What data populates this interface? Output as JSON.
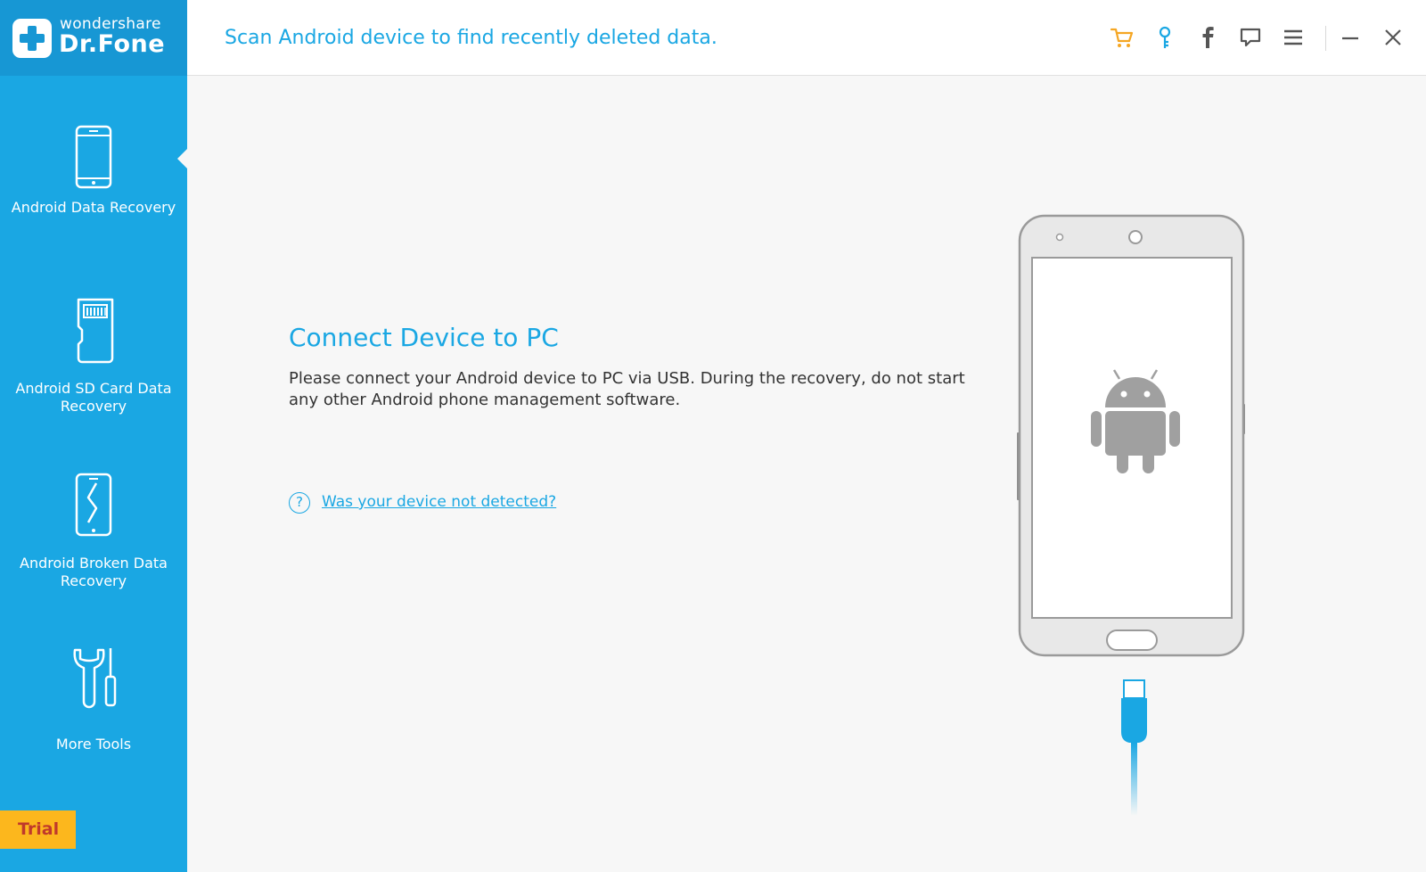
{
  "brand": {
    "name_small": "wondershare",
    "name_big": "Dr.Fone"
  },
  "header": {
    "title": "Scan Android device to find recently deleted data.",
    "icons": [
      "cart-icon",
      "key-icon",
      "facebook-icon",
      "chat-icon",
      "menu-icon",
      "minimize-icon",
      "close-icon"
    ],
    "accent_color": "#1aa7e3",
    "cart_color": "#f5a623"
  },
  "sidebar": {
    "items": [
      {
        "label": "Android Data Recovery",
        "icon": "phone-icon",
        "active": true
      },
      {
        "label": "Android SD Card Data Recovery",
        "icon": "sd-card-icon",
        "active": false
      },
      {
        "label": "Android Broken Data Recovery",
        "icon": "broken-phone-icon",
        "active": false
      },
      {
        "label": "More Tools",
        "icon": "tools-icon",
        "active": false
      }
    ],
    "trial_label": "Trial",
    "background": "#1aa7e3"
  },
  "main": {
    "connect_title": "Connect Device to PC",
    "connect_description": "Please connect your Android device to PC via USB. During the recovery, do not start any other Android phone management software.",
    "help_icon_glyph": "?",
    "help_link": "Was your device not detected?"
  }
}
